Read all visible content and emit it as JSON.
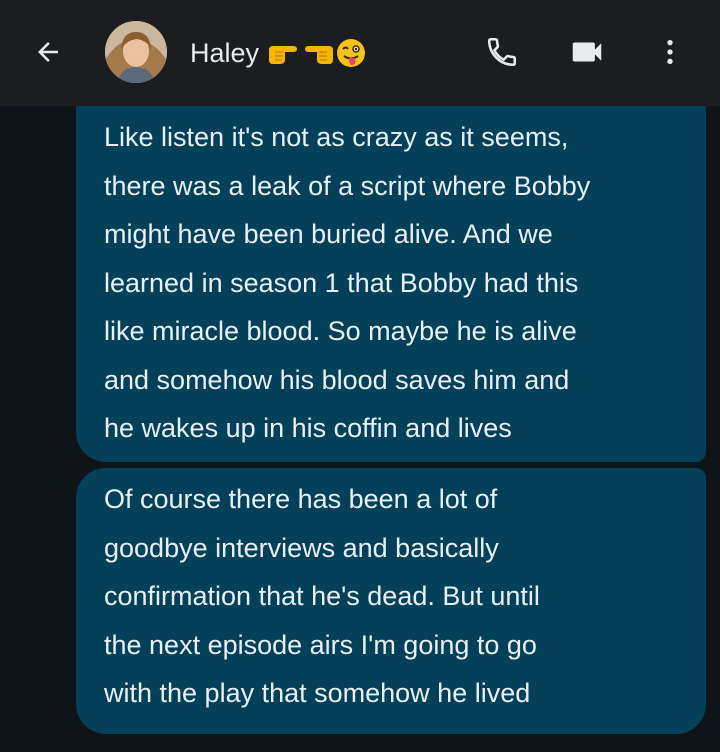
{
  "header": {
    "contact_name": "Haley",
    "name_emojis": [
      "point-right-emoji",
      "point-left-emoji",
      "winking-tongue-emoji"
    ],
    "avatar_label": "Haley avatar",
    "icons": {
      "back": "arrow-back-icon",
      "call": "phone-icon",
      "video": "video-camera-icon",
      "more": "more-vert-icon"
    }
  },
  "messages": [
    {
      "direction": "outgoing",
      "text": "Like listen it's not as crazy as it seems,\nthere was a leak of a script where Bobby\nmight have been buried alive. And we\nlearned in season 1 that Bobby had this\nlike miracle blood. So maybe he is alive\nand somehow his blood saves him and\nhe wakes up in his coffin and lives"
    },
    {
      "direction": "outgoing",
      "text": "Of course there has been a lot of\ngoodbye interviews and basically\nconfirmation that he's dead. But until\nthe next episode airs I'm going to go\nwith the play that somehow he lived"
    }
  ],
  "colors": {
    "header_bg": "#1c1d21",
    "chat_bg": "#0f1418",
    "bubble_bg": "#04405a",
    "text": "#e8f0f4"
  }
}
